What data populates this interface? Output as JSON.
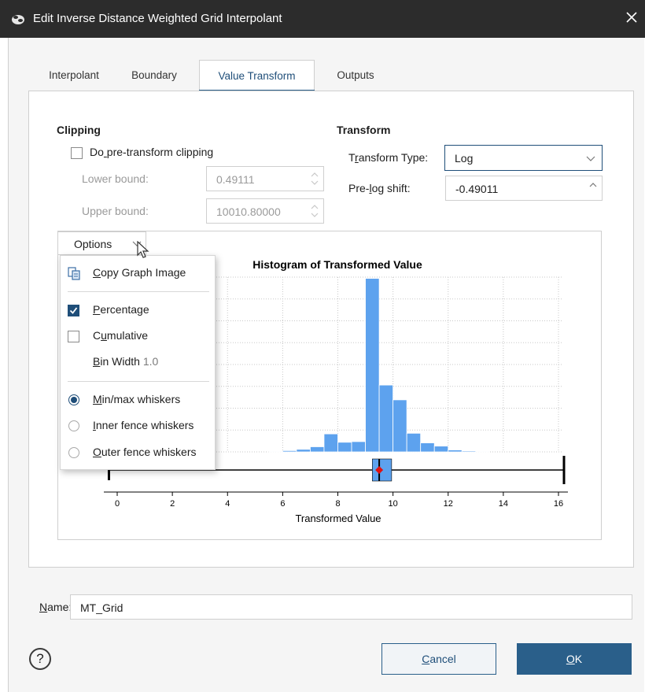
{
  "window": {
    "title": "Edit Inverse Distance Weighted Grid Interpolant"
  },
  "tabs": [
    {
      "label": "Interpolant",
      "active": false
    },
    {
      "label": "Boundary",
      "active": false
    },
    {
      "label": "Value Transform",
      "active": true
    },
    {
      "label": "Outputs",
      "active": false
    }
  ],
  "clipping": {
    "title": "Clipping",
    "pre_transform_label": "Do pre-transform clipping",
    "pre_transform_checked": false,
    "lower_bound_label": "Lower bound:",
    "lower_bound_value": "0.49111",
    "upper_bound_label": "Upper bound:",
    "upper_bound_value": "10010.80000"
  },
  "transform": {
    "title": "Transform",
    "type_label": "Transform Type:",
    "type_value": "Log",
    "shift_label": "Pre-log shift:",
    "shift_value": "-0.49011"
  },
  "options": {
    "button_label": "Options",
    "menu": {
      "copy_graph": "Copy Graph Image",
      "percentage": "Percentage",
      "percentage_checked": true,
      "cumulative": "Cumulative",
      "cumulative_checked": false,
      "bin_width_label": "Bin Width",
      "bin_width_value": "1.0",
      "whiskers": [
        {
          "label": "Min/max whiskers",
          "checked": true
        },
        {
          "label": "Inner fence whiskers",
          "checked": false
        },
        {
          "label": "Outer fence whiskers",
          "checked": false
        }
      ]
    }
  },
  "chart_data": {
    "type": "bar",
    "title": "Histogram of Transformed Value",
    "xlabel": "Transformed Value",
    "ylabel": "",
    "xlim": [
      -0.3,
      16.5
    ],
    "ylim": [
      0,
      28
    ],
    "x_ticks": [
      "0",
      "2",
      "4",
      "6",
      "8",
      "10",
      "12",
      "14",
      "16"
    ],
    "bar_color": "#5da2ee",
    "bins": [
      {
        "x0": 5.5,
        "x1": 6.0,
        "value": 0.1
      },
      {
        "x0": 6.0,
        "x1": 6.5,
        "value": 0.2
      },
      {
        "x0": 6.5,
        "x1": 7.0,
        "value": 0.4
      },
      {
        "x0": 7.0,
        "x1": 7.5,
        "value": 0.8
      },
      {
        "x0": 7.5,
        "x1": 8.0,
        "value": 2.8
      },
      {
        "x0": 8.0,
        "x1": 8.5,
        "value": 1.5
      },
      {
        "x0": 8.5,
        "x1": 9.0,
        "value": 1.6
      },
      {
        "x0": 9.0,
        "x1": 9.5,
        "value": 27.0
      },
      {
        "x0": 9.5,
        "x1": 10.0,
        "value": 10.4
      },
      {
        "x0": 10.0,
        "x1": 10.5,
        "value": 8.1
      },
      {
        "x0": 10.5,
        "x1": 11.0,
        "value": 2.9
      },
      {
        "x0": 11.0,
        "x1": 11.5,
        "value": 1.4
      },
      {
        "x0": 11.5,
        "x1": 12.0,
        "value": 0.9
      },
      {
        "x0": 12.0,
        "x1": 12.5,
        "value": 0.3
      },
      {
        "x0": 12.5,
        "x1": 13.0,
        "value": 0.15
      },
      {
        "x0": 13.0,
        "x1": 13.5,
        "value": 0.1
      }
    ],
    "boxplot": {
      "min": -0.3,
      "q1": 9.25,
      "median": 9.5,
      "mean": 9.5,
      "q3": 9.95,
      "max": 16.2
    },
    "grid": true
  },
  "name": {
    "label": "Name:",
    "value": "MT_Grid"
  },
  "buttons": {
    "cancel": "Cancel",
    "ok": "OK",
    "help": "?"
  }
}
